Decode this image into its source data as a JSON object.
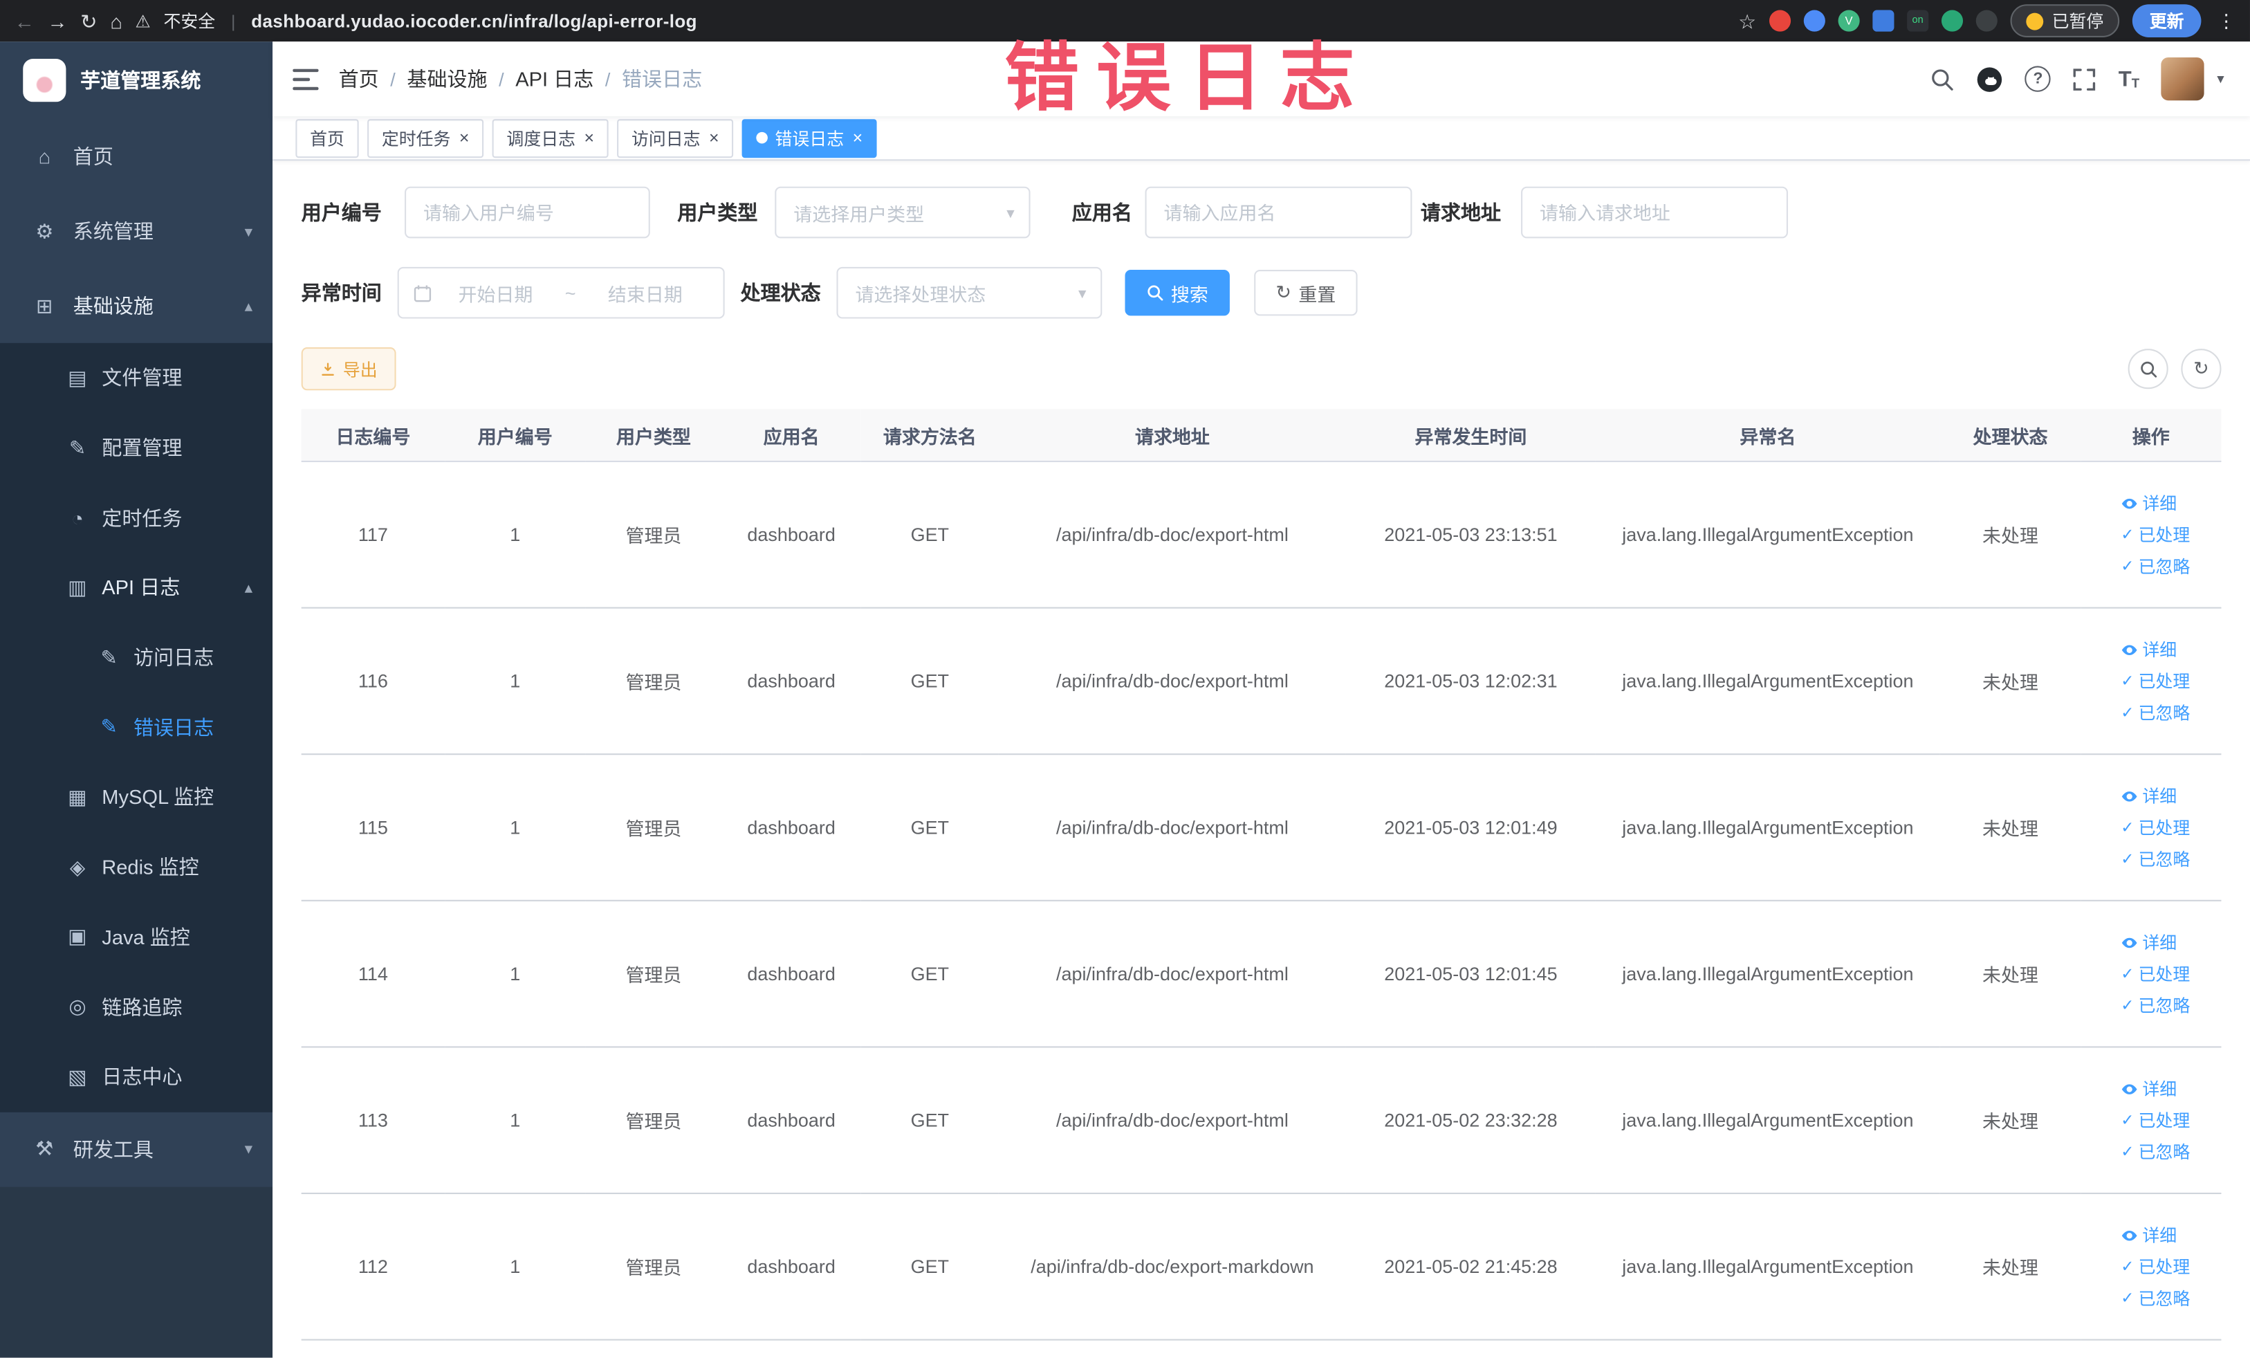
{
  "annotation": {
    "text": "错误日志"
  },
  "browser": {
    "security_label": "不安全",
    "url": "dashboard.yudao.iocoder.cn/infra/log/api-error-log",
    "paused_label": "已暂停",
    "update_label": "更新",
    "ext_v_label": "V",
    "ext_on_label": "on"
  },
  "icons": {
    "back": "←",
    "forward": "→",
    "reload": "↻",
    "home": "⌂",
    "warning": "⚠",
    "star": "☆",
    "kebab": "⋮",
    "close": "×",
    "question": "?",
    "chevron_down": "▾",
    "chevron_up": "▴",
    "caret_down": "▾",
    "menu_home": "⌂",
    "menu_system": "⚙",
    "menu_infra": "⊞",
    "menu_file": "▤",
    "menu_config": "✎",
    "menu_timer": "◔",
    "menu_apilog": "▥",
    "menu_doc": "✎",
    "menu_mysql": "▦",
    "menu_redis": "◈",
    "menu_java": "▣",
    "menu_trace": "◎",
    "menu_logcenter": "▧",
    "menu_tools": "⚒",
    "check": "✓",
    "reset": "↻",
    "refresh": "↻",
    "tsize_big": "T",
    "tsize_small": "T"
  },
  "sidebar": {
    "logo_title": "芋道管理系统",
    "items": [
      {
        "label": "首页"
      },
      {
        "label": "系统管理"
      },
      {
        "label": "基础设施",
        "children": [
          {
            "label": "文件管理"
          },
          {
            "label": "配置管理"
          },
          {
            "label": "定时任务"
          },
          {
            "label": "API 日志",
            "children": [
              {
                "label": "访问日志"
              },
              {
                "label": "错误日志"
              }
            ]
          },
          {
            "label": "MySQL 监控"
          },
          {
            "label": "Redis 监控"
          },
          {
            "label": "Java 监控"
          },
          {
            "label": "链路追踪"
          },
          {
            "label": "日志中心"
          }
        ]
      },
      {
        "label": "研发工具"
      }
    ]
  },
  "header": {
    "breadcrumb": [
      "首页",
      "基础设施",
      "API 日志",
      "错误日志"
    ]
  },
  "tabs": [
    {
      "label": "首页"
    },
    {
      "label": "定时任务"
    },
    {
      "label": "调度日志"
    },
    {
      "label": "访问日志"
    },
    {
      "label": "错误日志"
    }
  ],
  "filters": {
    "user_id": {
      "label": "用户编号",
      "placeholder": "请输入用户编号",
      "value": ""
    },
    "user_type": {
      "label": "用户类型",
      "placeholder": "请选择用户类型"
    },
    "app_name": {
      "label": "应用名",
      "placeholder": "请输入应用名",
      "value": ""
    },
    "request_url": {
      "label": "请求地址",
      "placeholder": "请输入请求地址",
      "value": ""
    },
    "exception_time": {
      "label": "异常时间",
      "start_placeholder": "开始日期",
      "separator": "~",
      "end_placeholder": "结束日期"
    },
    "process_status": {
      "label": "处理状态",
      "placeholder": "请选择处理状态"
    },
    "search_label": "搜索",
    "reset_label": "重置"
  },
  "toolbar": {
    "export_label": "导出"
  },
  "table": {
    "columns": [
      "日志编号",
      "用户编号",
      "用户类型",
      "应用名",
      "请求方法名",
      "请求地址",
      "异常发生时间",
      "异常名",
      "处理状态",
      "操作"
    ],
    "actions": [
      "详细",
      "已处理",
      "已忽略"
    ],
    "rows": [
      {
        "id": "117",
        "user_id": "1",
        "user_type": "管理员",
        "app": "dashboard",
        "method": "GET",
        "url": "/api/infra/db-doc/export-html",
        "time": "2021-05-03 23:13:51",
        "exception": "java.lang.IllegalArgumentException",
        "status": "未处理"
      },
      {
        "id": "116",
        "user_id": "1",
        "user_type": "管理员",
        "app": "dashboard",
        "method": "GET",
        "url": "/api/infra/db-doc/export-html",
        "time": "2021-05-03 12:02:31",
        "exception": "java.lang.IllegalArgumentException",
        "status": "未处理"
      },
      {
        "id": "115",
        "user_id": "1",
        "user_type": "管理员",
        "app": "dashboard",
        "method": "GET",
        "url": "/api/infra/db-doc/export-html",
        "time": "2021-05-03 12:01:49",
        "exception": "java.lang.IllegalArgumentException",
        "status": "未处理"
      },
      {
        "id": "114",
        "user_id": "1",
        "user_type": "管理员",
        "app": "dashboard",
        "method": "GET",
        "url": "/api/infra/db-doc/export-html",
        "time": "2021-05-03 12:01:45",
        "exception": "java.lang.IllegalArgumentException",
        "status": "未处理"
      },
      {
        "id": "113",
        "user_id": "1",
        "user_type": "管理员",
        "app": "dashboard",
        "method": "GET",
        "url": "/api/infra/db-doc/export-html",
        "time": "2021-05-02 23:32:28",
        "exception": "java.lang.IllegalArgumentException",
        "status": "未处理"
      },
      {
        "id": "112",
        "user_id": "1",
        "user_type": "管理员",
        "app": "dashboard",
        "method": "GET",
        "url": "/api/infra/db-doc/export-markdown",
        "time": "2021-05-02 21:45:28",
        "exception": "java.lang.IllegalArgumentException",
        "status": "未处理"
      }
    ]
  },
  "colors": {
    "primary": "#409eff",
    "warning": "#e6a23c",
    "sidebar_bg": "#304156",
    "submenu_bg": "#1f2d3d",
    "annotation": "#ef5168"
  }
}
